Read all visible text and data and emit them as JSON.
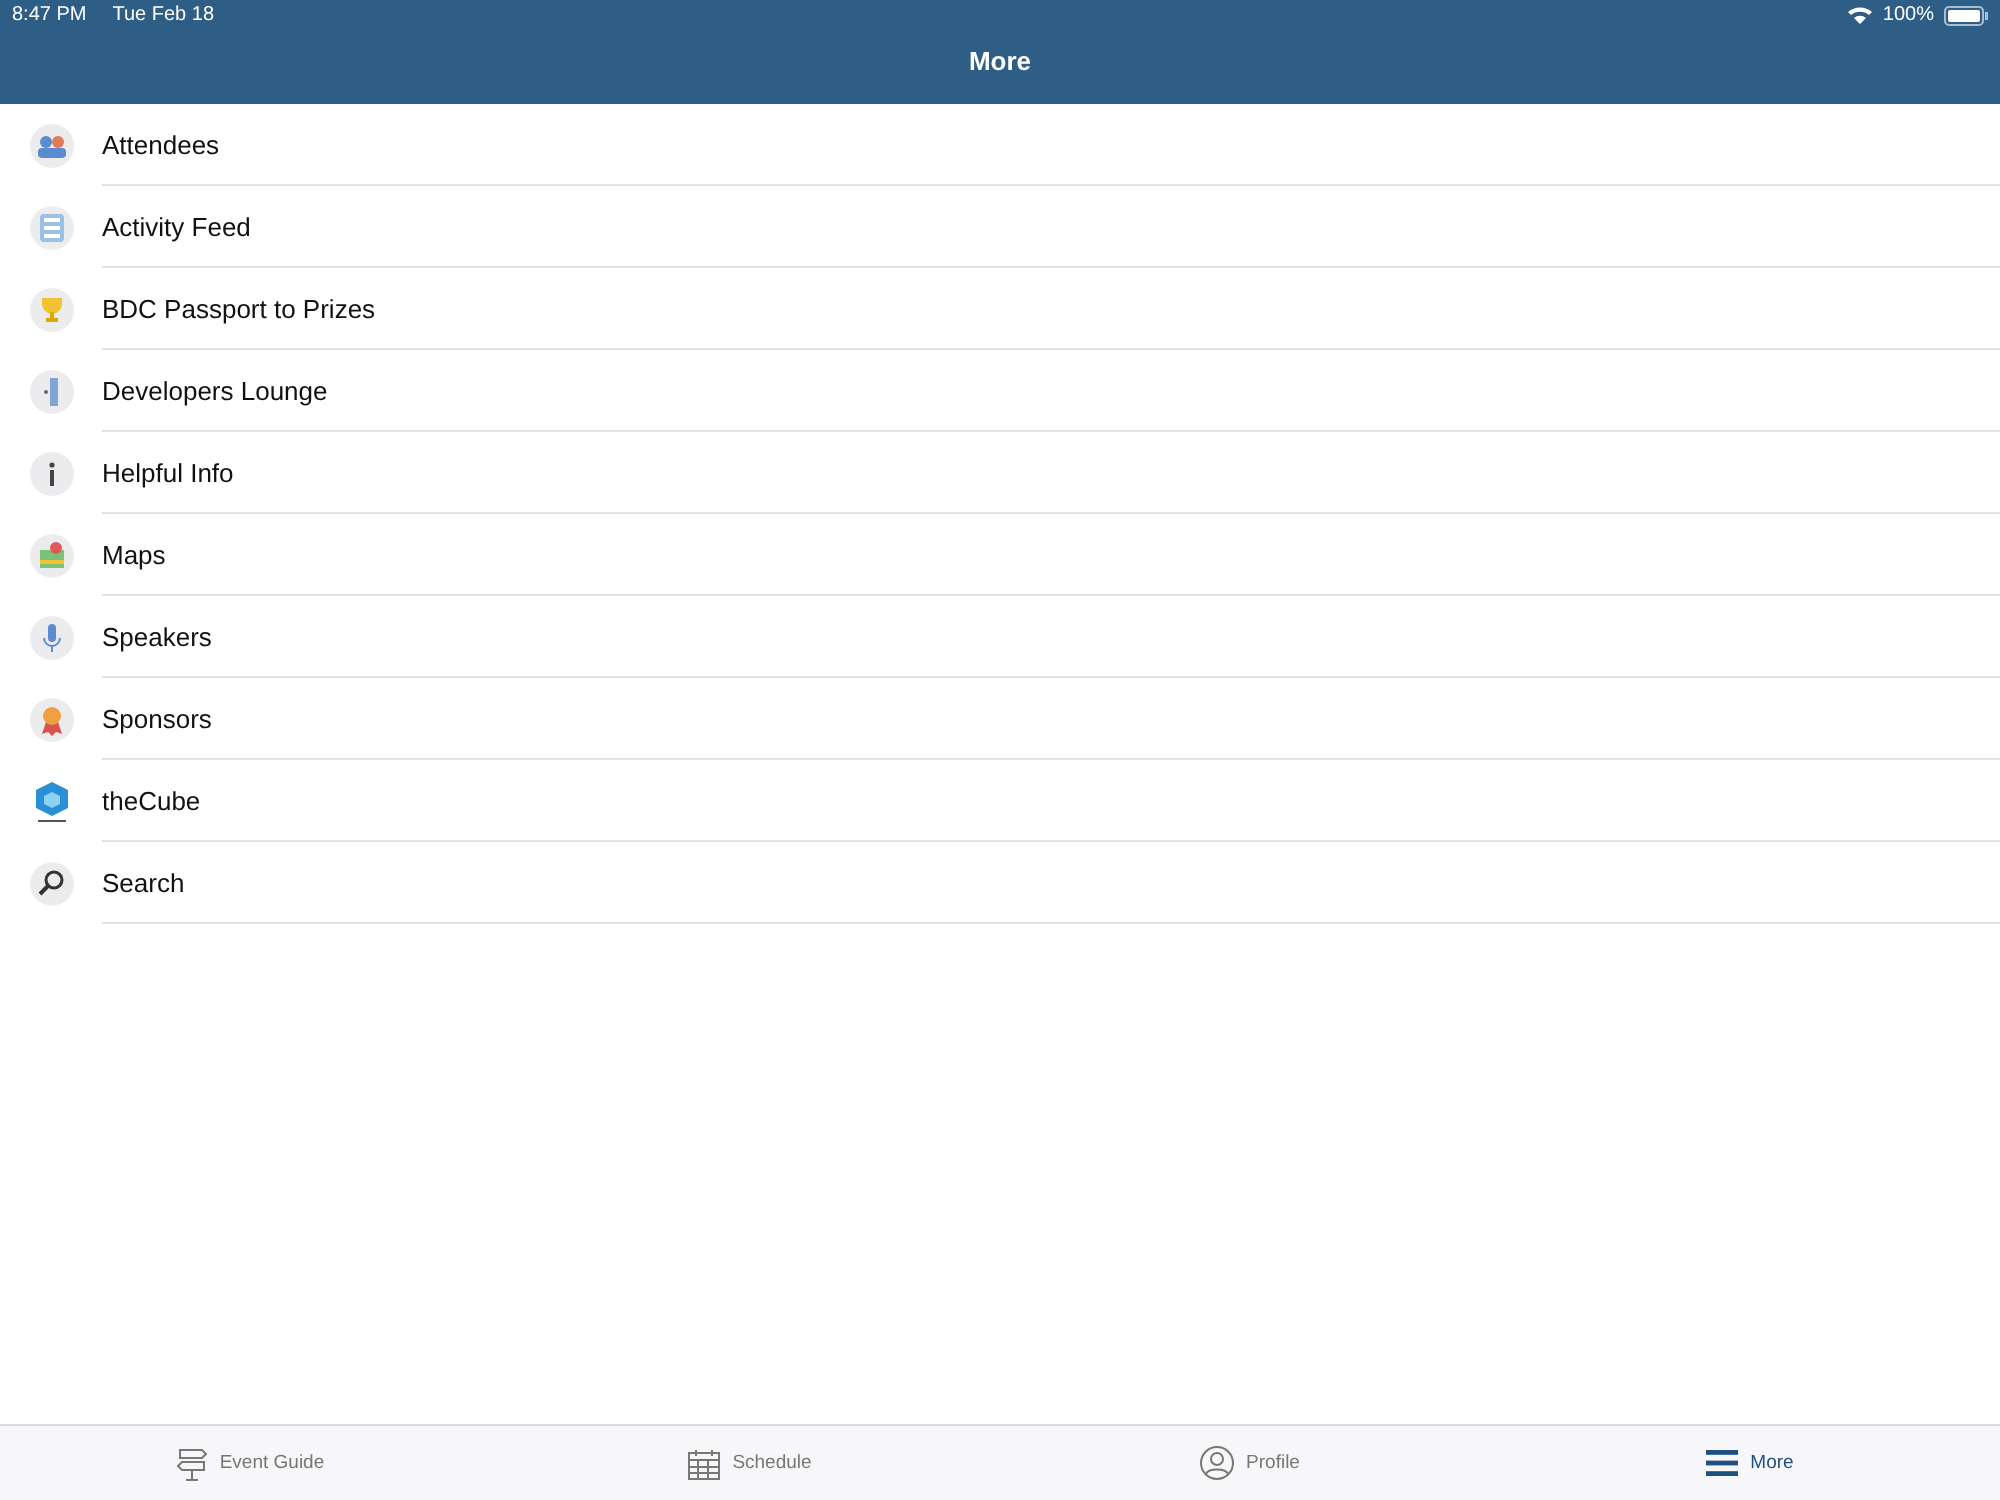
{
  "status_bar": {
    "time": "8:47 PM",
    "date": "Tue Feb 18",
    "battery": "100%"
  },
  "nav_bar": {
    "title": "More"
  },
  "items": [
    {
      "label": "Attendees",
      "kind": "people"
    },
    {
      "label": "Activity Feed",
      "kind": "feed"
    },
    {
      "label": "BDC Passport to Prizes",
      "kind": "trophy"
    },
    {
      "label": "Developers Lounge",
      "kind": "door"
    },
    {
      "label": "Helpful Info",
      "kind": "info"
    },
    {
      "label": "Maps",
      "kind": "map"
    },
    {
      "label": "Speakers",
      "kind": "mic"
    },
    {
      "label": "Sponsors",
      "kind": "ribbon"
    },
    {
      "label": "theCube",
      "kind": "cube"
    },
    {
      "label": "Search",
      "kind": "search"
    }
  ],
  "tab_bar": [
    {
      "label": "Event Guide",
      "kind": "signpost",
      "selected": false
    },
    {
      "label": "Schedule",
      "kind": "calendar",
      "selected": false
    },
    {
      "label": "Profile",
      "kind": "person",
      "selected": false
    },
    {
      "label": "More",
      "kind": "menu",
      "selected": true
    }
  ]
}
